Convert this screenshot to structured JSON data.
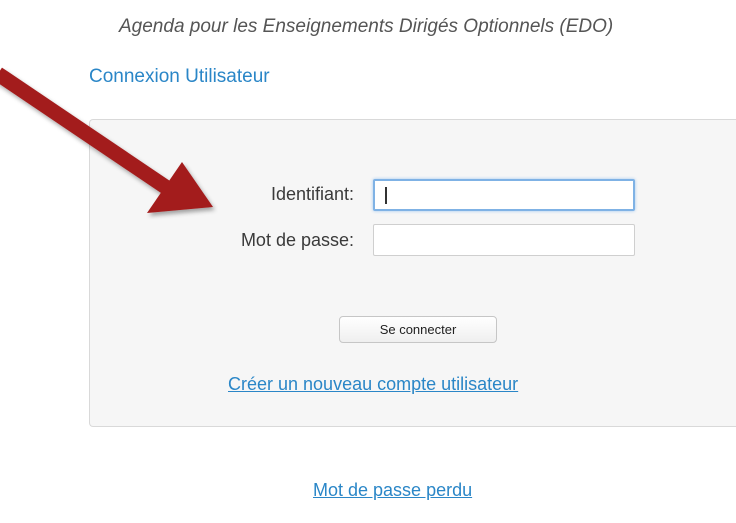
{
  "header": {
    "subtitle": "Agenda pour les Enseignements Dirigés Optionnels (EDO)"
  },
  "login": {
    "section_title": "Connexion Utilisateur",
    "username_label": "Identifiant:",
    "username_value": "",
    "password_label": "Mot de passe:",
    "password_value": "",
    "submit_label": "Se connecter",
    "create_account_label": "Créer un nouveau compte utilisateur"
  },
  "footer": {
    "lost_password_label": "Mot de passe perdu"
  },
  "annotation": {
    "icon": "arrow-pointer-icon",
    "color": "#a31b1b"
  },
  "colors": {
    "link": "#2a86c7",
    "focus_border": "#7fb2e5",
    "panel_bg": "#f6f6f6"
  }
}
